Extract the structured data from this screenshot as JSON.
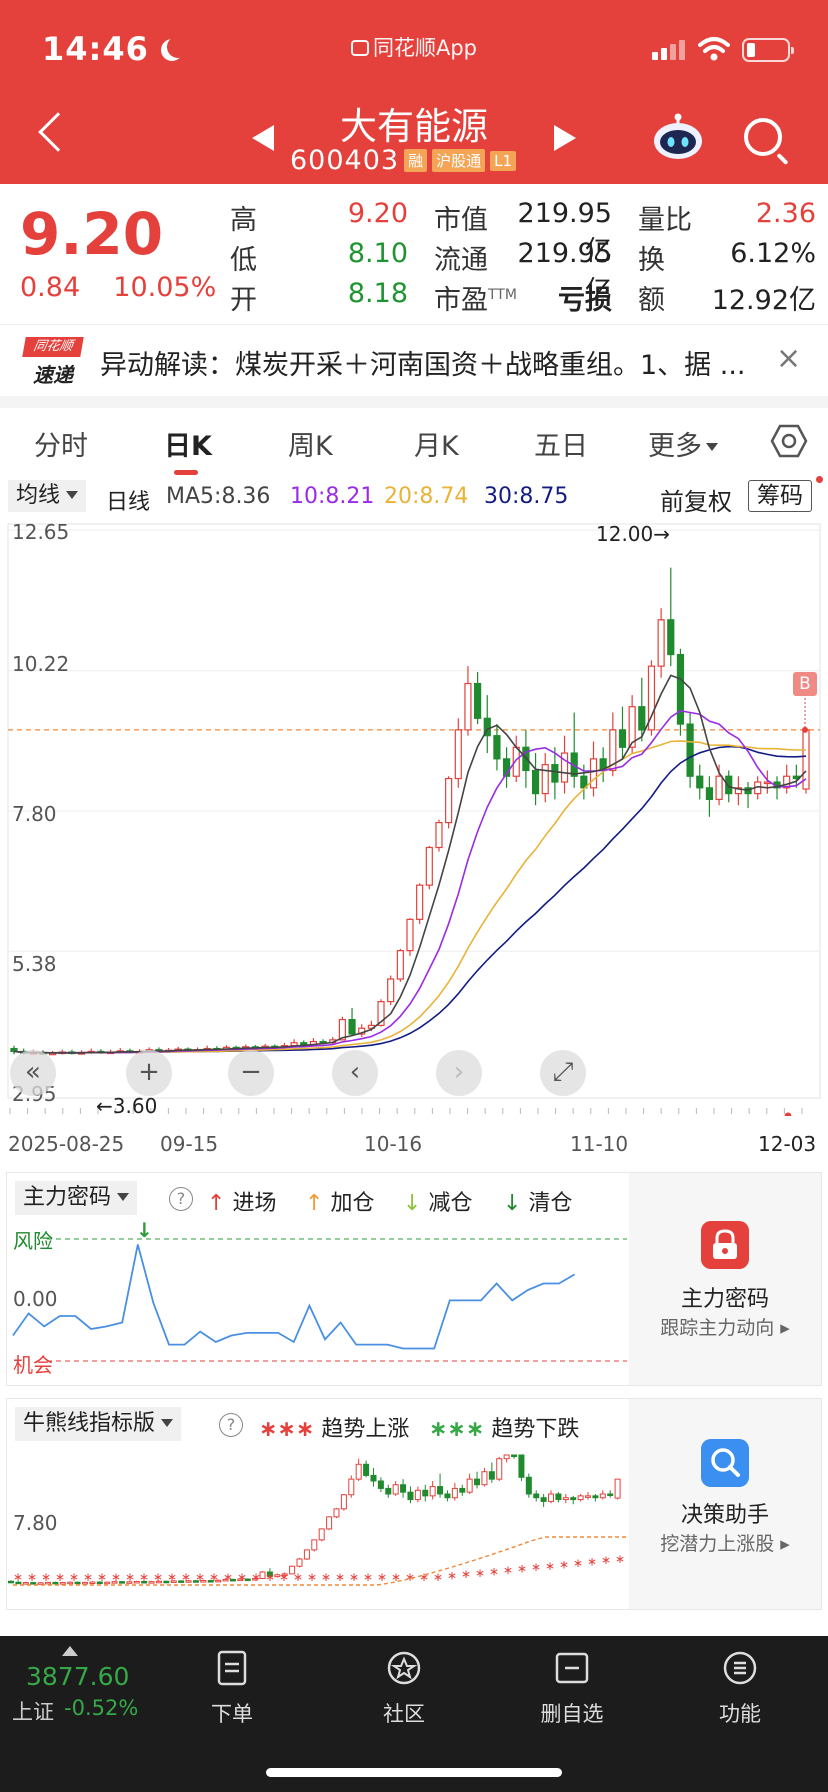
{
  "status": {
    "time": "14:46",
    "app": "同花顺App"
  },
  "stock": {
    "name": "大有能源",
    "code": "600403",
    "tags": [
      "融",
      "沪股通",
      "L1"
    ],
    "price": "9.20",
    "change": "0.84",
    "change_pct": "10.05%"
  },
  "quote": {
    "high_label": "高",
    "high": "9.20",
    "low_label": "低",
    "low": "8.10",
    "open_label": "开",
    "open": "8.18",
    "mktcap_label": "市值",
    "mktcap": "219.95亿",
    "float_label": "流通",
    "float": "219.95亿",
    "pe_label": "市盈",
    "pe_sup": "TTM",
    "pe": "亏损",
    "vr_label": "量比",
    "vr": "2.36",
    "turnover_label": "换",
    "turnover": "6.12%",
    "amount_label": "额",
    "amount": "12.92亿"
  },
  "news": {
    "logo_top": "同花顺",
    "logo_bottom": "速递",
    "text": "异动解读：煤炭开采＋河南国资＋战略重组。1、据 ...",
    "close": "×"
  },
  "tabs": [
    {
      "label": "分时"
    },
    {
      "label": "日K"
    },
    {
      "label": "周K"
    },
    {
      "label": "月K"
    },
    {
      "label": "五日"
    },
    {
      "label": "更多"
    }
  ],
  "ma": {
    "selector": "均线",
    "period": "日线",
    "ma5": "MA5:8.36",
    "ma10": "10:8.21",
    "ma20": "20:8.74",
    "ma30": "30:8.75",
    "adjust": "前复权",
    "chip": "筹码",
    "colors": {
      "ma5": "#444444",
      "ma10": "#9a2be6",
      "ma20": "#e9b338",
      "ma30": "#131c83",
      "up": "#e5413c",
      "down": "#1f8a2e"
    }
  },
  "main_chart": {
    "y_labels": [
      "12.65",
      "10.22",
      "7.80",
      "5.38",
      "2.95"
    ],
    "annotation_high": "12.00→",
    "annotation_low": "←3.60",
    "x_labels": [
      "2025-08-25",
      "09-15",
      "10-16",
      "11-10",
      "12-03"
    ],
    "b_marker": "B",
    "ref_price_line": 9.2
  },
  "chart_data": {
    "type": "candlestick",
    "ylim": [
      2.95,
      12.65
    ],
    "x_start": "2025-08-25",
    "x_end": "12-03",
    "high": 12.0,
    "low": 3.6,
    "candles": [
      [
        3.7,
        3.65,
        3.75,
        3.6
      ],
      [
        3.65,
        3.62,
        3.7,
        3.6
      ],
      [
        3.62,
        3.63,
        3.68,
        3.6
      ],
      [
        3.63,
        3.61,
        3.67,
        3.6
      ],
      [
        3.61,
        3.62,
        3.66,
        3.6
      ],
      [
        3.62,
        3.64,
        3.68,
        3.6
      ],
      [
        3.64,
        3.62,
        3.68,
        3.6
      ],
      [
        3.62,
        3.63,
        3.67,
        3.6
      ],
      [
        3.63,
        3.65,
        3.7,
        3.61
      ],
      [
        3.65,
        3.63,
        3.69,
        3.61
      ],
      [
        3.63,
        3.64,
        3.68,
        3.61
      ],
      [
        3.64,
        3.66,
        3.71,
        3.62
      ],
      [
        3.66,
        3.64,
        3.7,
        3.62
      ],
      [
        3.64,
        3.65,
        3.69,
        3.62
      ],
      [
        3.65,
        3.68,
        3.72,
        3.63
      ],
      [
        3.68,
        3.66,
        3.72,
        3.63
      ],
      [
        3.66,
        3.67,
        3.71,
        3.64
      ],
      [
        3.67,
        3.69,
        3.73,
        3.65
      ],
      [
        3.69,
        3.67,
        3.72,
        3.65
      ],
      [
        3.67,
        3.68,
        3.72,
        3.65
      ],
      [
        3.68,
        3.7,
        3.75,
        3.66
      ],
      [
        3.7,
        3.69,
        3.74,
        3.66
      ],
      [
        3.69,
        3.72,
        3.76,
        3.67
      ],
      [
        3.72,
        3.7,
        3.75,
        3.68
      ],
      [
        3.7,
        3.73,
        3.77,
        3.69
      ],
      [
        3.73,
        3.71,
        3.76,
        3.69
      ],
      [
        3.71,
        3.74,
        3.78,
        3.7
      ],
      [
        3.74,
        3.72,
        3.77,
        3.7
      ],
      [
        3.72,
        3.75,
        3.8,
        3.71
      ],
      [
        3.75,
        3.8,
        3.86,
        3.73
      ],
      [
        3.8,
        3.76,
        3.84,
        3.73
      ],
      [
        3.76,
        3.82,
        3.88,
        3.75
      ],
      [
        3.82,
        3.8,
        3.86,
        3.77
      ],
      [
        3.8,
        3.85,
        3.9,
        3.78
      ],
      [
        3.85,
        4.2,
        4.25,
        3.84
      ],
      [
        4.2,
        3.95,
        4.4,
        3.92
      ],
      [
        3.95,
        4.05,
        4.12,
        3.9
      ],
      [
        4.05,
        4.1,
        4.18,
        4.0
      ],
      [
        4.1,
        4.51,
        4.55,
        4.08
      ],
      [
        4.51,
        4.9,
        4.96,
        4.45
      ],
      [
        4.9,
        5.39,
        5.42,
        4.85
      ],
      [
        5.39,
        5.93,
        5.95,
        5.3
      ],
      [
        5.93,
        6.52,
        6.55,
        5.85
      ],
      [
        6.52,
        7.17,
        7.2,
        6.45
      ],
      [
        7.17,
        7.6,
        7.65,
        7.1
      ],
      [
        7.6,
        8.36,
        8.4,
        7.5
      ],
      [
        8.36,
        9.2,
        9.4,
        8.2
      ],
      [
        9.2,
        10.0,
        10.3,
        9.1
      ],
      [
        10.0,
        9.4,
        10.2,
        9.3
      ],
      [
        9.4,
        9.1,
        9.8,
        8.8
      ],
      [
        9.1,
        8.7,
        9.3,
        8.5
      ],
      [
        8.7,
        8.4,
        8.9,
        8.2
      ],
      [
        8.4,
        8.9,
        9.1,
        8.3
      ],
      [
        8.9,
        8.5,
        9.2,
        8.2
      ],
      [
        8.5,
        8.1,
        8.8,
        7.9
      ],
      [
        8.1,
        8.6,
        8.8,
        7.95
      ],
      [
        8.6,
        8.3,
        8.9,
        8.0
      ],
      [
        8.3,
        8.8,
        9.1,
        8.1
      ],
      [
        8.8,
        8.4,
        9.5,
        8.2
      ],
      [
        8.4,
        8.2,
        8.6,
        8.0
      ],
      [
        8.2,
        8.7,
        9.0,
        8.05
      ],
      [
        8.7,
        8.5,
        8.9,
        8.3
      ],
      [
        8.5,
        9.2,
        9.5,
        8.4
      ],
      [
        9.2,
        8.9,
        9.6,
        8.7
      ],
      [
        8.9,
        9.6,
        9.8,
        8.8
      ],
      [
        9.6,
        9.2,
        10.1,
        9.0
      ],
      [
        9.2,
        10.3,
        10.4,
        9.1
      ],
      [
        10.3,
        11.1,
        11.3,
        10.1
      ],
      [
        11.1,
        10.5,
        12.0,
        10.3
      ],
      [
        10.5,
        9.3,
        10.6,
        9.1
      ],
      [
        9.3,
        8.4,
        9.5,
        8.2
      ],
      [
        8.4,
        8.2,
        8.6,
        8.0
      ],
      [
        8.2,
        8.0,
        8.4,
        7.7
      ],
      [
        8.0,
        8.4,
        8.6,
        7.9
      ],
      [
        8.4,
        8.1,
        8.5,
        7.95
      ],
      [
        8.1,
        8.2,
        8.4,
        7.9
      ],
      [
        8.2,
        8.1,
        8.3,
        7.85
      ],
      [
        8.1,
        8.3,
        8.4,
        8.0
      ],
      [
        8.3,
        8.3,
        8.5,
        8.1
      ],
      [
        8.3,
        8.2,
        8.4,
        8.0
      ],
      [
        8.2,
        8.4,
        8.6,
        8.1
      ],
      [
        8.4,
        8.36,
        8.6,
        8.2
      ],
      [
        8.18,
        9.2,
        9.2,
        8.1
      ]
    ]
  },
  "indicator1": {
    "name": "主力密码",
    "legend": [
      {
        "label": "进场",
        "color": "#e5413c"
      },
      {
        "label": "加仓",
        "color": "#f09a35"
      },
      {
        "label": "减仓",
        "color": "#8fc23a"
      },
      {
        "label": "清仓",
        "color": "#1f8a2e"
      }
    ],
    "y_labels": {
      "risk": "风险",
      "zero": "0.00",
      "chance": "机会"
    },
    "side_title": "主力密码",
    "side_sub": "跟踪主力动向 ▸"
  },
  "indicator2": {
    "name": "牛熊线指标版",
    "legend": [
      {
        "label": "趋势上涨",
        "color": "#e5413c"
      },
      {
        "label": "趋势下跌",
        "color": "#36a847"
      }
    ],
    "y_label": "7.80",
    "side_title": "决策助手",
    "side_sub": "挖潜力上涨股 ▸"
  },
  "bottom": {
    "index_value": "3877.60",
    "index_name": "上证",
    "index_change": "-0.52%",
    "nav": [
      {
        "label": "下单"
      },
      {
        "label": "社区"
      },
      {
        "label": "删自选"
      },
      {
        "label": "功能"
      }
    ]
  }
}
